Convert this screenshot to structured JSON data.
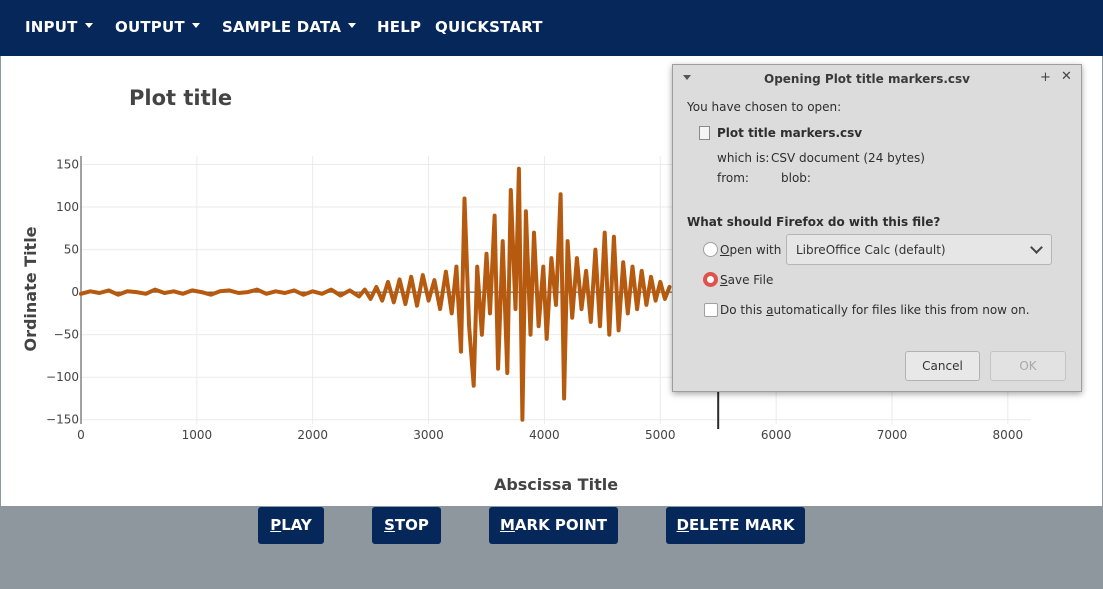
{
  "nav": {
    "input": "INPUT",
    "output": "OUTPUT",
    "sample_data": "SAMPLE DATA",
    "help": "HELP",
    "quickstart": "QUICKSTART"
  },
  "colors": {
    "nav_bg": "#06275a",
    "trace": "#b65a0f",
    "control_bg": "#8e979e",
    "radio_checked": "#e0524c"
  },
  "chart_data": {
    "type": "line",
    "title": "Plot title",
    "xlabel": "Abscissa Title",
    "ylabel": "Ordinate Title",
    "xlim": [
      0,
      8200
    ],
    "ylim": [
      -155,
      160
    ],
    "xticks": [
      0,
      1000,
      2000,
      3000,
      4000,
      5000,
      6000,
      7000,
      8000
    ],
    "xtick_labels": [
      "0",
      "1000",
      "2000",
      "3000",
      "4000",
      "5000",
      "6000",
      "7000",
      "8000"
    ],
    "yticks": [
      150,
      100,
      50,
      0,
      -50,
      -100,
      -150
    ],
    "ytick_labels": [
      "150",
      "100",
      "50",
      "0",
      "−50",
      "−100",
      "−150"
    ],
    "grid": true,
    "marker_x": 5500,
    "series": [
      {
        "x": [
          0,
          80,
          160,
          240,
          320,
          400,
          480,
          560,
          640,
          720,
          800,
          880,
          960,
          1040,
          1120,
          1200,
          1280,
          1360,
          1440,
          1520,
          1600,
          1680,
          1760,
          1840,
          1920,
          2000,
          2080,
          2160,
          2240,
          2320,
          2400,
          2450,
          2500,
          2550,
          2600,
          2650,
          2700,
          2750,
          2800,
          2850,
          2900,
          2950,
          3000,
          3050,
          3100,
          3150,
          3200,
          3240,
          3280,
          3310,
          3350,
          3390,
          3420,
          3460,
          3500,
          3530,
          3570,
          3600,
          3640,
          3680,
          3710,
          3750,
          3780,
          3810,
          3840,
          3880,
          3910,
          3950,
          3990,
          4020,
          4060,
          4100,
          4140,
          4170,
          4200,
          4240,
          4280,
          4320,
          4360,
          4400,
          4440,
          4480,
          4520,
          4560,
          4600,
          4640,
          4680,
          4720,
          4760,
          4800,
          4840,
          4880,
          4920,
          4960,
          5000,
          5040,
          5080
        ],
        "y": [
          -2,
          1,
          -1,
          2,
          -3,
          1,
          0,
          -2,
          3,
          -1,
          1,
          -2,
          2,
          0,
          -3,
          1,
          2,
          -1,
          0,
          3,
          -2,
          1,
          -1,
          2,
          -3,
          1,
          -2,
          3,
          -4,
          2,
          -5,
          3,
          -8,
          6,
          -10,
          12,
          -12,
          15,
          -14,
          18,
          -16,
          20,
          -10,
          14,
          -20,
          24,
          -25,
          30,
          -70,
          110,
          -40,
          -110,
          30,
          -50,
          45,
          -25,
          90,
          -90,
          60,
          -95,
          120,
          -20,
          145,
          -150,
          95,
          -50,
          70,
          -40,
          30,
          -55,
          40,
          -15,
          115,
          -125,
          60,
          -30,
          40,
          -20,
          25,
          -35,
          50,
          -40,
          70,
          -50,
          65,
          -45,
          35,
          -25,
          30,
          -20,
          25,
          -15,
          18,
          -10,
          12,
          -8,
          6
        ]
      }
    ]
  },
  "controls": {
    "play": {
      "u": "P",
      "rest": "LAY"
    },
    "stop": {
      "u": "S",
      "rest": "TOP"
    },
    "mark_point": {
      "u": "M",
      "rest": "ARK POINT"
    },
    "delete_mark": {
      "u": "D",
      "rest": "ELETE MARK"
    }
  },
  "dialog": {
    "title": "Opening Plot title markers.csv",
    "chosen_text": "You have chosen to open:",
    "file_name": "Plot title markers.csv",
    "which_is_label": "which is:",
    "which_is_value": "CSV document (24 bytes)",
    "from_label": "from:",
    "from_value": "blob:",
    "question": "What should Firefox do with this file?",
    "open_with_u": "O",
    "open_with_rest": "pen with",
    "open_with_app": "LibreOffice Calc (default)",
    "save_file_u": "S",
    "save_file_rest": "ave File",
    "auto_pre": "Do this ",
    "auto_u": "a",
    "auto_rest": "utomatically for files like this from now on.",
    "cancel": "Cancel",
    "ok": "OK",
    "selected_option": "save_file",
    "auto_checked": false
  }
}
